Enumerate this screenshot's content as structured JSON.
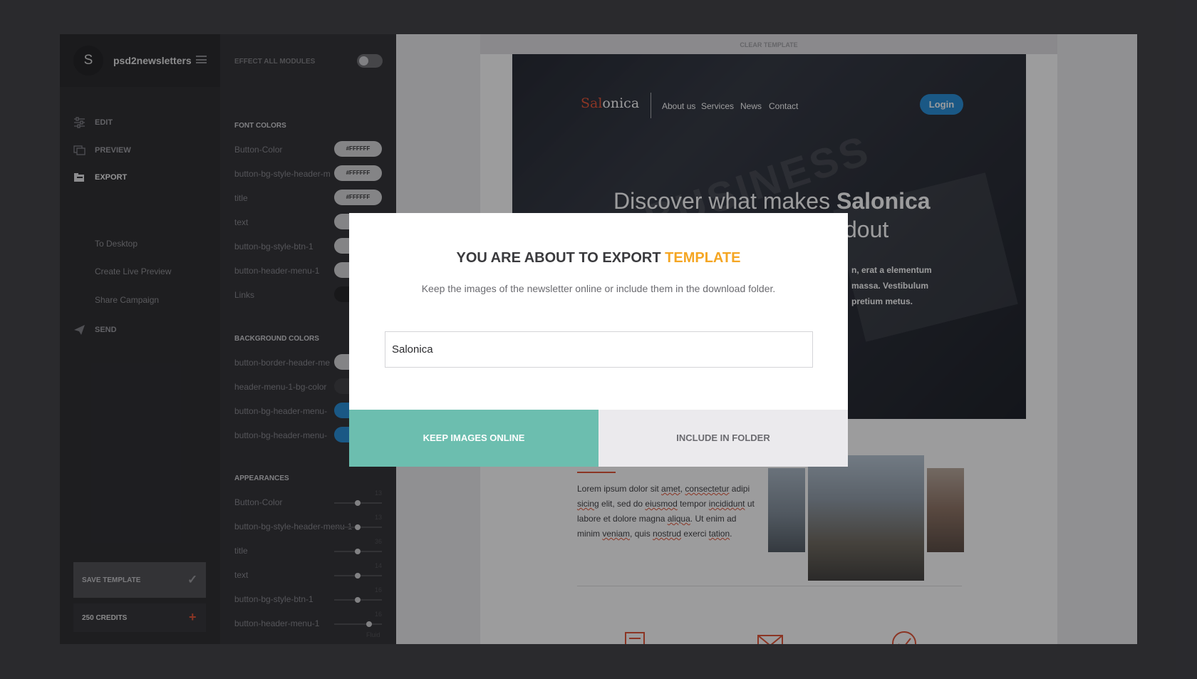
{
  "nav": {
    "avatar_letter": "S",
    "brand": "psd2newsletters",
    "items": [
      {
        "label": "EDIT",
        "icon": "sliders-icon"
      },
      {
        "label": "PREVIEW",
        "icon": "preview-icon"
      },
      {
        "label": "EXPORT",
        "icon": "export-icon"
      },
      {
        "label": "SEND",
        "icon": "paper-plane-icon"
      }
    ],
    "export_sub": [
      "To Desktop",
      "Create Live Preview",
      "Share Campaign"
    ],
    "save_label": "SAVE TEMPLATE",
    "credits_label": "250 CREDITS",
    "credits_plus": "+"
  },
  "settings": {
    "effect_all": "EFFECT ALL MODULES",
    "font_colors_title": "FONT COLORS",
    "font_colors": [
      {
        "label": "Button-Color",
        "value": "#FFFFFF"
      },
      {
        "label": "button-bg-style-header-m",
        "value": "#FFFFFF"
      },
      {
        "label": "title",
        "value": "#FFFFFF"
      },
      {
        "label": "text",
        "value": ""
      },
      {
        "label": "button-bg-style-btn-1",
        "value": ""
      },
      {
        "label": "button-header-menu-1",
        "value": ""
      },
      {
        "label": "Links",
        "value": ""
      }
    ],
    "bg_colors_title": "BACKGROUND COLORS",
    "bg_colors": [
      {
        "label": "button-border-header-me"
      },
      {
        "label": "header-menu-1-bg-color"
      },
      {
        "label": "button-bg-header-menu-"
      },
      {
        "label": "button-bg-header-menu-"
      }
    ],
    "appearances_title": "APPEARANCES",
    "appearances": [
      {
        "label": "Button-Color",
        "value": "13"
      },
      {
        "label": "button-bg-style-header-menu-1",
        "value": "13"
      },
      {
        "label": "title",
        "value": "36"
      },
      {
        "label": "text",
        "value": "14"
      },
      {
        "label": "button-bg-style-btn-1",
        "value": "16"
      },
      {
        "label": "button-header-menu-1",
        "value": "16"
      }
    ],
    "appearance_last_note": "Fluid"
  },
  "preview": {
    "clear_template": "CLEAR TEMPLATE",
    "logo_accent": "Sal",
    "logo_rest": "onica",
    "nav_links": [
      "About us",
      "Services",
      "News",
      "Contact"
    ],
    "login": "Login",
    "hero_word": "BUSINESS",
    "heading_plain": "Discover what makes ",
    "heading_bold": "Salonica",
    "heading_line2": "dout",
    "hero_lines": [
      "n, erat a elementum",
      "massa. Vestibulum",
      "pretium metus."
    ],
    "content_text": [
      {
        "t": "Lorem ipsum dolor sit ",
        "sq": false
      },
      {
        "t": "amet",
        "sq": true
      },
      {
        "t": ", ",
        "sq": false
      },
      {
        "t": "consectetur",
        "sq": true
      },
      {
        "t": " adipi ",
        "sq": false
      },
      {
        "t": "sicing",
        "sq": true
      },
      {
        "t": " elit, sed do ",
        "sq": false
      },
      {
        "t": "eiusmod",
        "sq": true
      },
      {
        "t": " tempor ",
        "sq": false
      },
      {
        "t": "incididunt",
        "sq": true
      },
      {
        "t": " ut labore et dolore magna ",
        "sq": false
      },
      {
        "t": "aliqua",
        "sq": true
      },
      {
        "t": ". Ut enim ad minim ",
        "sq": false
      },
      {
        "t": "veniam",
        "sq": true
      },
      {
        "t": ", quis ",
        "sq": false
      },
      {
        "t": "nostrud",
        "sq": true
      },
      {
        "t": " exerci ",
        "sq": false
      },
      {
        "t": "tation",
        "sq": true
      },
      {
        "t": ".",
        "sq": false
      }
    ]
  },
  "modal": {
    "title_plain": "YOU ARE ABOUT TO EXPORT ",
    "title_accent": "TEMPLATE",
    "subtitle": "Keep the images of the newsletter online or include them in the download folder.",
    "input_value": "Salonica",
    "keep_btn": "KEEP IMAGES ONLINE",
    "include_btn": "INCLUDE IN FOLDER"
  },
  "colors": {
    "accent_teal": "#6cbeaf",
    "accent_orange": "#f5a623",
    "accent_red": "#e24e2f",
    "accent_blue": "#1f8ad6"
  }
}
